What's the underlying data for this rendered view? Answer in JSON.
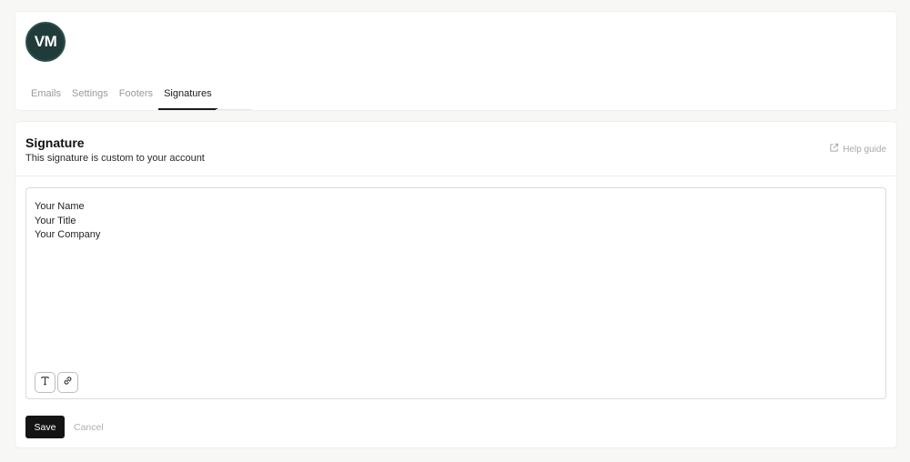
{
  "profile": {
    "initials": "VM"
  },
  "tabs": [
    {
      "label": "Emails"
    },
    {
      "label": "Settings"
    },
    {
      "label": "Footers"
    },
    {
      "label": "Signatures",
      "active": true
    }
  ],
  "signature": {
    "title": "Signature",
    "subtitle": "This signature is custom to your account",
    "help_label": "Help guide",
    "lines": [
      "Your Name",
      "Your Title",
      "Your Company"
    ],
    "tools": [
      "text-format-icon",
      "link-icon"
    ],
    "save_label": "Save",
    "cancel_label": "Cancel"
  }
}
